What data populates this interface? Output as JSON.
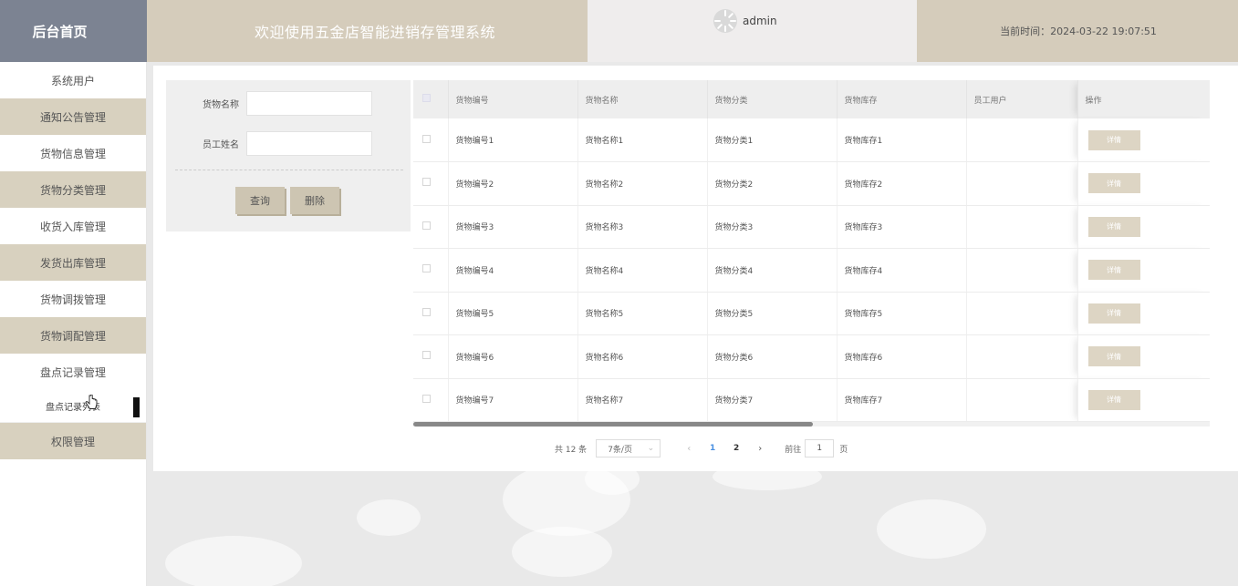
{
  "header": {
    "home_label": "后台首页",
    "welcome_title": "欢迎使用五金店智能进销存管理系统",
    "username": "admin",
    "time_label": "当前时间：2024-03-22 19:07:51"
  },
  "sidebar": {
    "items": [
      {
        "label": "系统用户"
      },
      {
        "label": "通知公告管理"
      },
      {
        "label": "货物信息管理"
      },
      {
        "label": "货物分类管理"
      },
      {
        "label": "收货入库管理"
      },
      {
        "label": "发货出库管理"
      },
      {
        "label": "货物调拨管理"
      },
      {
        "label": "货物调配管理"
      },
      {
        "label": "盘点记录管理"
      },
      {
        "label": "盘点记录列表"
      },
      {
        "label": "权限管理"
      }
    ]
  },
  "search": {
    "field1_label": "货物名称",
    "field1_value": "",
    "field2_label": "员工姓名",
    "field2_value": "",
    "query_button": "查询",
    "delete_button": "删除"
  },
  "table": {
    "headers": [
      "货物编号",
      "货物名称",
      "货物分类",
      "货物库存",
      "员工用户",
      "操作"
    ],
    "detail_label": "详情",
    "rows": [
      {
        "code": "货物编号1",
        "name": "货物名称1",
        "category": "货物分类1",
        "stock": "货物库存1",
        "user": ""
      },
      {
        "code": "货物编号2",
        "name": "货物名称2",
        "category": "货物分类2",
        "stock": "货物库存2",
        "user": ""
      },
      {
        "code": "货物编号3",
        "name": "货物名称3",
        "category": "货物分类3",
        "stock": "货物库存3",
        "user": ""
      },
      {
        "code": "货物编号4",
        "name": "货物名称4",
        "category": "货物分类4",
        "stock": "货物库存4",
        "user": ""
      },
      {
        "code": "货物编号5",
        "name": "货物名称5",
        "category": "货物分类5",
        "stock": "货物库存5",
        "user": ""
      },
      {
        "code": "货物编号6",
        "name": "货物名称6",
        "category": "货物分类6",
        "stock": "货物库存6",
        "user": ""
      },
      {
        "code": "货物编号7",
        "name": "货物名称7",
        "category": "货物分类7",
        "stock": "货物库存7",
        "user": ""
      }
    ]
  },
  "pagination": {
    "total": "共 12 条",
    "page_size": "7条/页",
    "pages": [
      "1",
      "2"
    ],
    "current_page": "1",
    "goto_label": "前往",
    "goto_value": "1",
    "goto_unit": "页"
  }
}
